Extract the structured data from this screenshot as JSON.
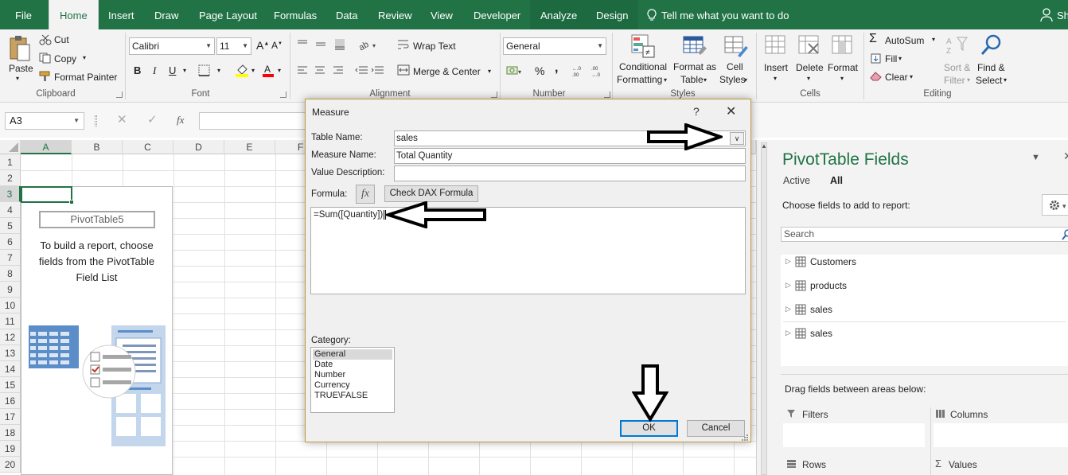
{
  "tabs": [
    {
      "id": "file",
      "label": "File"
    },
    {
      "id": "home",
      "label": "Home"
    },
    {
      "id": "insert",
      "label": "Insert"
    },
    {
      "id": "draw",
      "label": "Draw"
    },
    {
      "id": "page_layout",
      "label": "Page Layout"
    },
    {
      "id": "formulas",
      "label": "Formulas"
    },
    {
      "id": "data",
      "label": "Data"
    },
    {
      "id": "review",
      "label": "Review"
    },
    {
      "id": "view",
      "label": "View"
    },
    {
      "id": "developer",
      "label": "Developer"
    },
    {
      "id": "analyze",
      "label": "Analyze"
    },
    {
      "id": "design",
      "label": "Design"
    }
  ],
  "tell_me": "Tell me what you want to do",
  "user_initials": "Sh",
  "ribbon": {
    "clipboard": {
      "paste": "Paste",
      "cut": "Cut",
      "copy": "Copy",
      "format_painter": "Format Painter",
      "label": "Clipboard"
    },
    "font": {
      "name": "Calibri",
      "size": "11",
      "bold": "B",
      "italic": "I",
      "underline": "U",
      "label": "Font"
    },
    "alignment": {
      "wrap_text": "Wrap Text",
      "merge_center": "Merge & Center",
      "label": "Alignment"
    },
    "number": {
      "format": "General",
      "percent": "%",
      "comma": ",",
      "label": "Number"
    },
    "styles": {
      "conditional_1": "Conditional",
      "conditional_2": "Formatting",
      "format_table_1": "Format as",
      "format_table_2": "Table",
      "cell_styles_1": "Cell",
      "cell_styles_2": "Styles",
      "label": "Styles"
    },
    "cells": {
      "insert": "Insert",
      "delete": "Delete",
      "format": "Format",
      "label": "Cells"
    },
    "editing": {
      "autosum": "AutoSum",
      "fill": "Fill",
      "clear": "Clear",
      "sort_1": "Sort &",
      "sort_2": "Filter",
      "find_1": "Find &",
      "find_2": "Select",
      "label": "Editing"
    }
  },
  "formula_bar": {
    "name_box": "A3",
    "fx": "fx"
  },
  "grid": {
    "columns": [
      "A",
      "B",
      "C",
      "D",
      "E",
      "F"
    ],
    "rows": [
      "1",
      "2",
      "3",
      "4",
      "5",
      "6",
      "7",
      "8",
      "9",
      "10",
      "11",
      "12",
      "13",
      "14",
      "15",
      "16",
      "17",
      "18",
      "19",
      "20"
    ]
  },
  "pivot_placeholder": {
    "title": "PivotTable5",
    "line1": "To build a report, choose",
    "line2": "fields from the PivotTable",
    "line3": "Field List"
  },
  "dialog": {
    "title": "Measure",
    "help": "?",
    "table_name_label": "Table Name:",
    "table_name_value": "sales",
    "measure_name_label": "Measure Name:",
    "measure_name_value": "Total Quantity",
    "value_description_label": "Value Description:",
    "value_description_value": "",
    "formula_label": "Formula:",
    "fx_button": "fx",
    "check_dax": "Check DAX Formula",
    "formula_value": "=Sum([Quantity])",
    "category_label": "Category:",
    "categories": [
      "General",
      "Date",
      "Number",
      "Currency",
      "TRUE\\FALSE"
    ],
    "selected_category": "General",
    "ok": "OK",
    "cancel": "Cancel"
  },
  "pane": {
    "title": "PivotTable Fields",
    "tab_active": "Active",
    "tab_all": "All",
    "choose": "Choose fields to add to report:",
    "search_placeholder": "Search",
    "fields": [
      "Customers",
      "products",
      "sales",
      "sales"
    ],
    "drag": "Drag fields between areas below:",
    "filters": "Filters",
    "columns": "Columns",
    "rows": "Rows",
    "values": "Values"
  },
  "colors": {
    "excel_green": "#217346",
    "accent_blue": "#0078d7",
    "arrow": "#000000"
  }
}
